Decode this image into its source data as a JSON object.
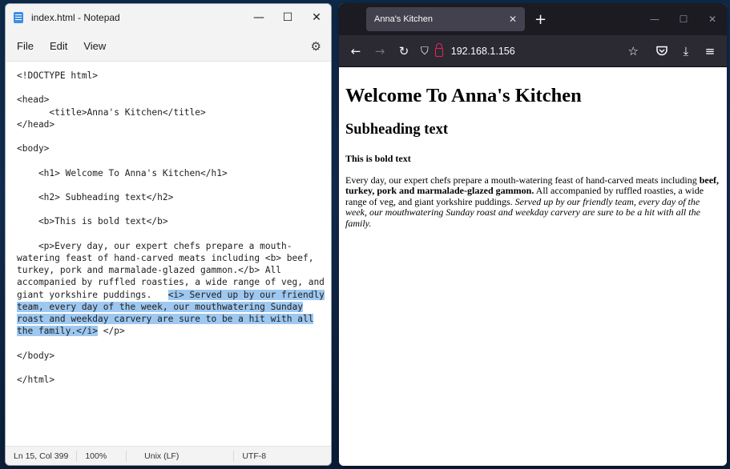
{
  "notepad": {
    "title": "index.html - Notepad",
    "minimize": "—",
    "maximize": "☐",
    "close": "✕",
    "menu": [
      "File",
      "Edit",
      "View"
    ],
    "settings_icon": "gear-icon",
    "code_lines": [
      "<!DOCTYPE html>",
      "",
      "<head>",
      "      <title>Anna's Kitchen</title>",
      "</head>",
      "",
      "<body>",
      "",
      "    <h1> Welcome To Anna's Kitchen</h1>",
      "",
      "    <h2> Subheading text</h2>",
      "",
      "    <b>This is bold text</b>",
      "",
      "    <p>Every day, our expert chefs prepare a mouth-",
      "watering feast of hand-carved meats including <b> beef,",
      "turkey, pork and marmalade-glazed gammon.</b> All",
      "accompanied by ruffled roasties, a wide range of veg, and"
    ],
    "selection_line_prefix": "giant yorkshire puddings.   ",
    "selection_lines": [
      "<i> Served up by our friendly",
      "team, every day of the week, our mouthwatering Sunday",
      "roast and weekday carvery are sure to be a hit with all",
      "the family.</i>"
    ],
    "selection_suffix": " </p>",
    "code_tail": [
      "",
      "</body>",
      "",
      "</html>"
    ],
    "status": {
      "position": "Ln 15, Col 399",
      "zoom": "100%",
      "line_endings": "Unix (LF)",
      "encoding": "UTF-8"
    }
  },
  "browser": {
    "tab_title": "Anna's Kitchen",
    "tab_close": "✕",
    "new_tab": "+",
    "win_minimize": "—",
    "win_maximize": "☐",
    "win_close": "✕",
    "url": "192.168.1.156",
    "page": {
      "h1": "Welcome To Anna's Kitchen",
      "h2": "Subheading text",
      "bold_text": "This is bold text",
      "para_start": "Every day, our expert chefs prepare a mouth-watering feast of hand-carved meats including ",
      "para_bold": "beef, turkey, pork and marmalade-glazed gammon.",
      "para_middle": " All accompanied by ruffled roasties, a wide range of veg, and giant yorkshire puddings. ",
      "para_italic": "Served up by our friendly team, every day of the week, our mouthwatering Sunday roast and weekday carvery are sure to be a hit with all the family."
    }
  }
}
